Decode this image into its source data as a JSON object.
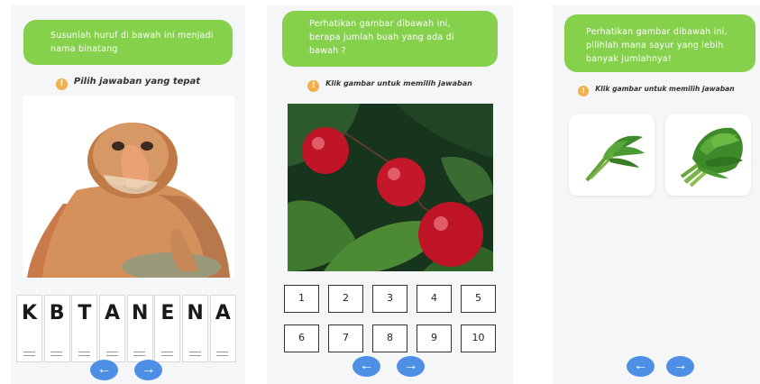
{
  "screens": [
    {
      "instruction": "Susunlah huruf di bawah ini menjadi nama binatang",
      "hint": "Pilih jawaban yang tepat",
      "letters": [
        "K",
        "B",
        "T",
        "A",
        "N",
        "E",
        "N",
        "A"
      ],
      "image_icon": "proboscis-monkey"
    },
    {
      "instruction": "Perhatikan gambar dibawah ini, berapa jumlah buah yang ada di bawah ?",
      "hint": "Klik gambar untuk memilih jawaban",
      "numbers": [
        "1",
        "2",
        "3",
        "4",
        "5",
        "6",
        "7",
        "8",
        "9",
        "10"
      ],
      "image_icon": "red-fruits"
    },
    {
      "instruction": "Perhatikan gambar dibawah ini, pilihlah mana sayur yang lebih banyak jumlahnya!",
      "hint": "Klik gambar untuk memilih jawaban",
      "choices": [
        "small-vegetable-bunch",
        "large-vegetable-bunch"
      ]
    }
  ],
  "icons": {
    "info": "info-icon",
    "back": "arrow-left-icon",
    "next": "arrow-right-icon",
    "info_glyph": "!",
    "back_glyph": "←",
    "next_glyph": "→"
  },
  "colors": {
    "bubble": "#86d14c",
    "nav_button": "#4e8fe6",
    "info_icon": "#f2b04a",
    "screen_bg": "#f5f6f8"
  }
}
